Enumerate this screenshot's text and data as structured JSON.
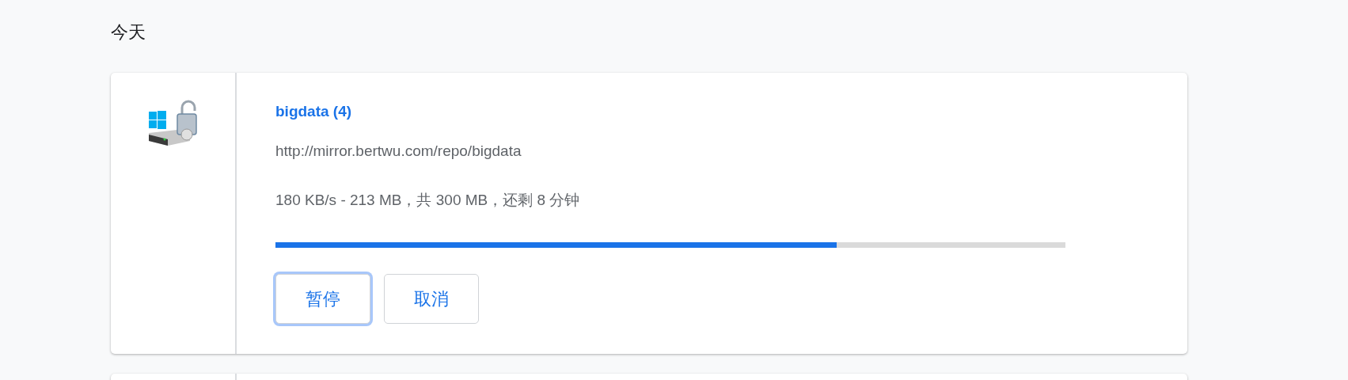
{
  "section_heading": "今天",
  "downloads": [
    {
      "title": "bigdata (4)",
      "url": "http://mirror.bertwu.com/repo/bigdata",
      "status": "180 KB/s - 213 MB，共 300 MB，还剩 8 分钟",
      "level": 0.71,
      "buttons": [
        {
          "label": "暂停",
          "focused": true
        },
        {
          "label": "取消",
          "focused": false
        }
      ]
    }
  ]
}
